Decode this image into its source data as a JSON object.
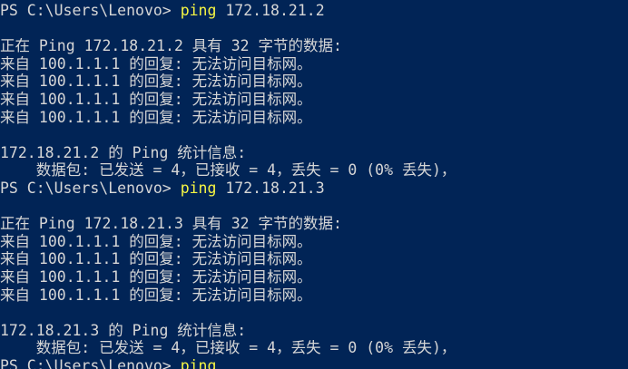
{
  "colors": {
    "background": "#012456",
    "text": "#d6d6d6",
    "command": "#f5f543"
  },
  "lines": [
    {
      "prompt": "PS C:\\Users\\Lenovo> ",
      "cmd": "ping",
      "args": " 172.18.21.2"
    },
    {
      "text": ""
    },
    {
      "text": "正在 Ping 172.18.21.2 具有 32 字节的数据:"
    },
    {
      "text": "来自 100.1.1.1 的回复: 无法访问目标网。"
    },
    {
      "text": "来自 100.1.1.1 的回复: 无法访问目标网。"
    },
    {
      "text": "来自 100.1.1.1 的回复: 无法访问目标网。"
    },
    {
      "text": "来自 100.1.1.1 的回复: 无法访问目标网。"
    },
    {
      "text": ""
    },
    {
      "text": "172.18.21.2 的 Ping 统计信息:"
    },
    {
      "text": "    数据包: 已发送 = 4，已接收 = 4，丢失 = 0 (0% 丢失)，"
    },
    {
      "prompt": "PS C:\\Users\\Lenovo> ",
      "cmd": "ping",
      "args": " 172.18.21.3"
    },
    {
      "text": ""
    },
    {
      "text": "正在 Ping 172.18.21.3 具有 32 字节的数据:"
    },
    {
      "text": "来自 100.1.1.1 的回复: 无法访问目标网。"
    },
    {
      "text": "来自 100.1.1.1 的回复: 无法访问目标网。"
    },
    {
      "text": "来自 100.1.1.1 的回复: 无法访问目标网。"
    },
    {
      "text": "来自 100.1.1.1 的回复: 无法访问目标网。"
    },
    {
      "text": ""
    },
    {
      "text": "172.18.21.3 的 Ping 统计信息:"
    },
    {
      "text": "    数据包: 已发送 = 4，已接收 = 4，丢失 = 0 (0% 丢失)，"
    },
    {
      "prompt": "PS C:\\Users\\Lenovo> ",
      "cmd": "ping",
      "args": ""
    }
  ]
}
